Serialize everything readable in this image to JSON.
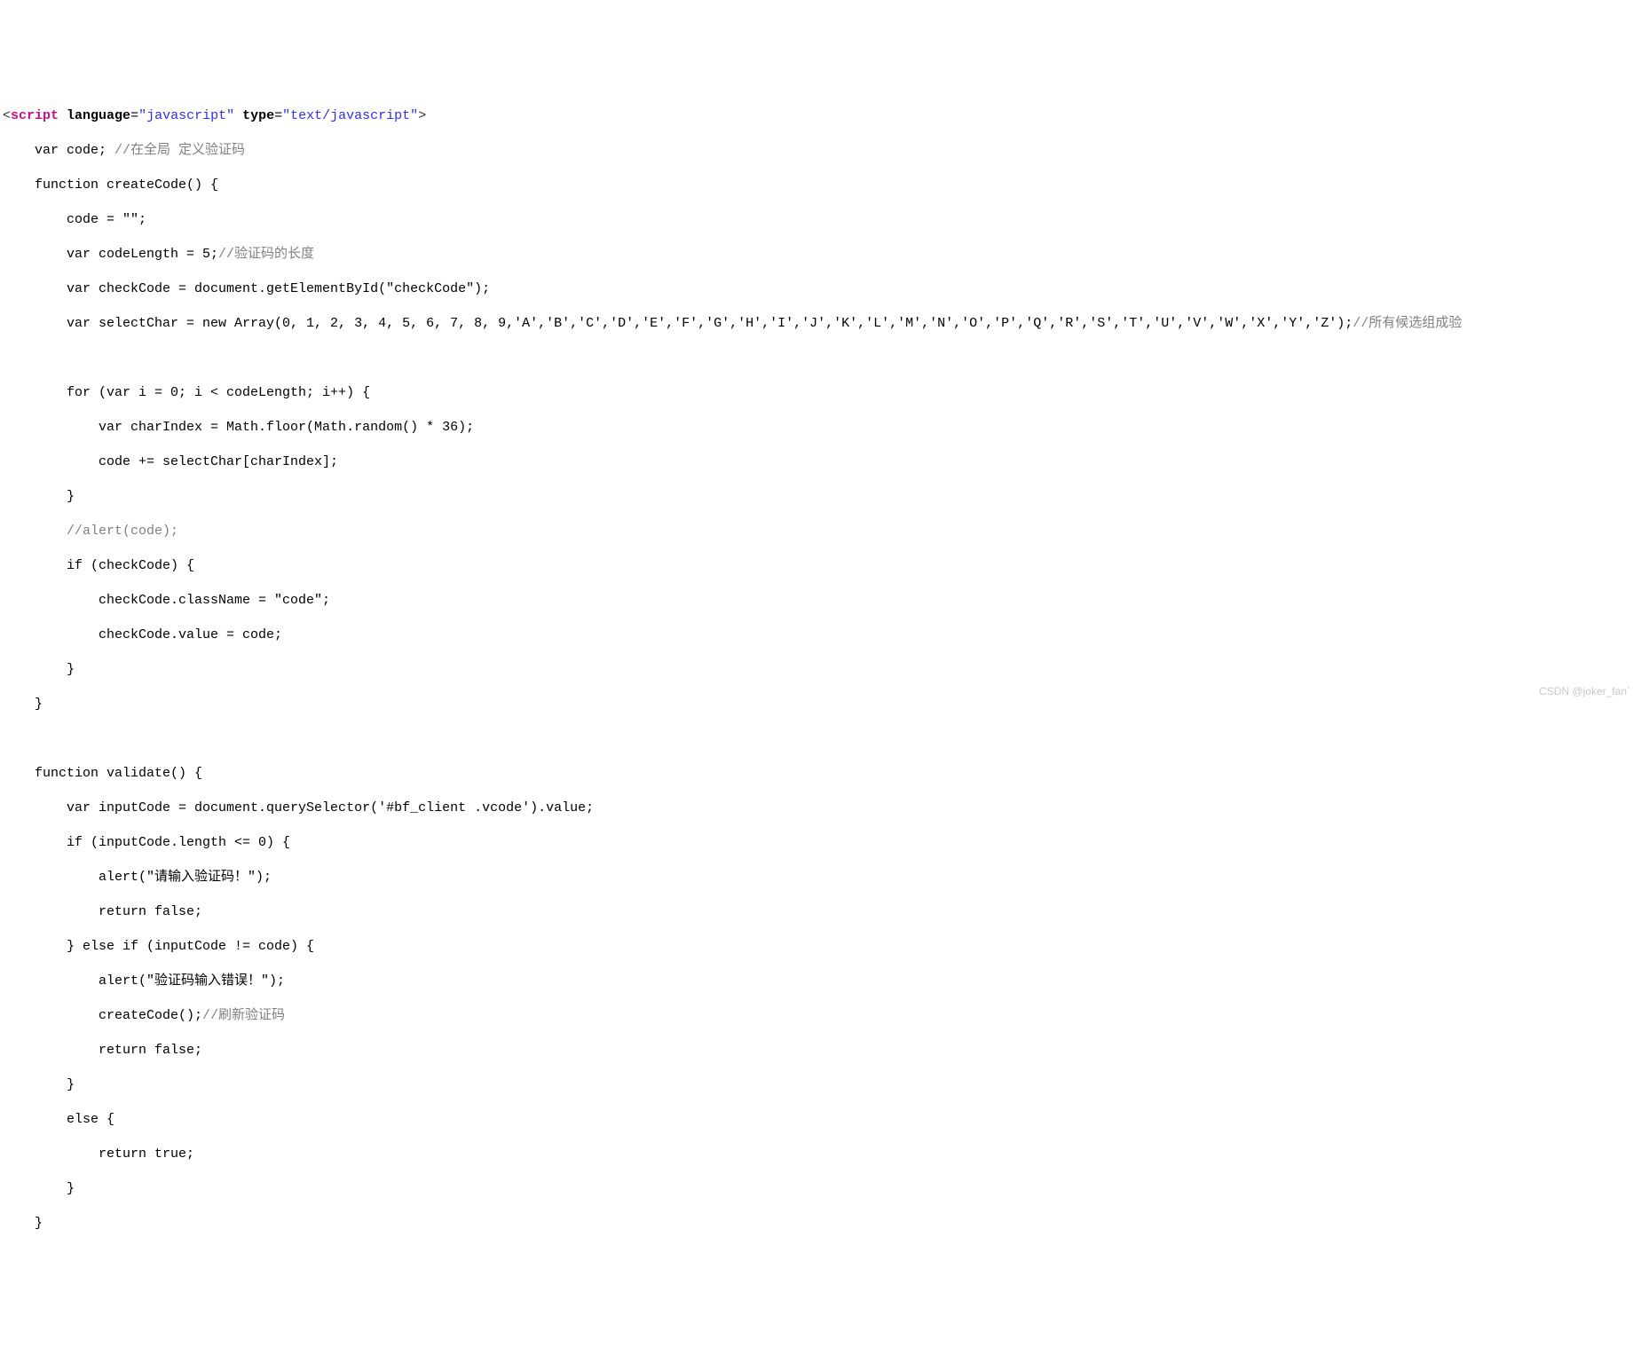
{
  "tag": {
    "open": "<",
    "close": ">",
    "name": "script",
    "attr1_name": "language",
    "attr1_eq": "=",
    "attr1_val": "\"javascript\"",
    "attr2_name": "type",
    "attr2_eq": "=",
    "attr2_val": "\"text/javascript\""
  },
  "l02a": "    var code; ",
  "l02b": "//在全局 定义验证码",
  "l03": "    function createCode() {",
  "l04": "        code = \"\";",
  "l05a": "        var codeLength = 5;",
  "l05b": "//验证码的长度",
  "l06": "        var checkCode = document.getElementById(\"checkCode\");",
  "l07a": "        var selectChar = new Array(0, 1, 2, 3, 4, 5, 6, 7, 8, 9,'A','B','C','D','E','F','G','H','I','J','K','L','M','N','O','P','Q','R','S','T','U','V','W','X','Y','Z');",
  "l07b": "//所有候选组成验",
  "l08": " ",
  "l09": "        for (var i = 0; i < codeLength; i++) {",
  "l10": "            var charIndex = Math.floor(Math.random() * 36);",
  "l11": "            code += selectChar[charIndex];",
  "l12": "        }",
  "l13": "        //alert(code);",
  "l14": "        if (checkCode) {",
  "l15": "            checkCode.className = \"code\";",
  "l16": "            checkCode.value = code;",
  "l17": "        }",
  "l18": "    }",
  "l19": " ",
  "l20": "    function validate() {",
  "l21": "        var inputCode = document.querySelector('#bf_client .vcode').value;",
  "l22": "        if (inputCode.length <= 0) {",
  "l23": "            alert(\"请输入验证码！\");",
  "l24": "            return false;",
  "l25": "        } else if (inputCode != code) {",
  "l26": "            alert(\"验证码输入错误！\");",
  "l27a": "            createCode();",
  "l27b": "//刷新验证码",
  "l28": "            return false;",
  "l29": "        }",
  "l30": "        else {",
  "l31": "            return true;",
  "l32": "        }",
  "l33": "    }",
  "watermark": "CSDN @joker_fan`"
}
